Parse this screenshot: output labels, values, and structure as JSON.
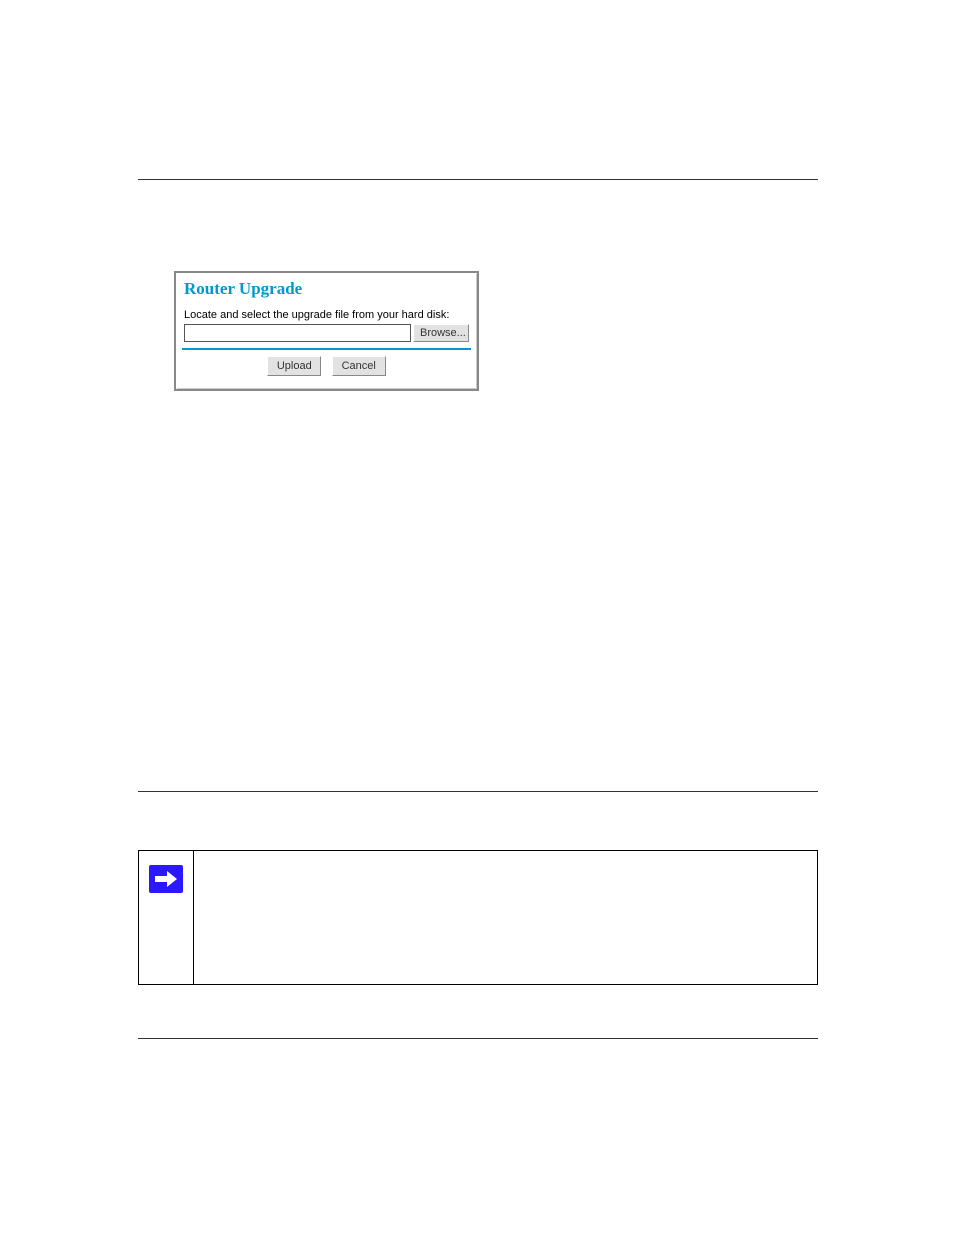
{
  "panel": {
    "title": "Router Upgrade",
    "instruction": "Locate and select the upgrade file from your hard disk:",
    "file_value": "",
    "browse_label": "Browse...",
    "upload_label": "Upload",
    "cancel_label": "Cancel"
  }
}
